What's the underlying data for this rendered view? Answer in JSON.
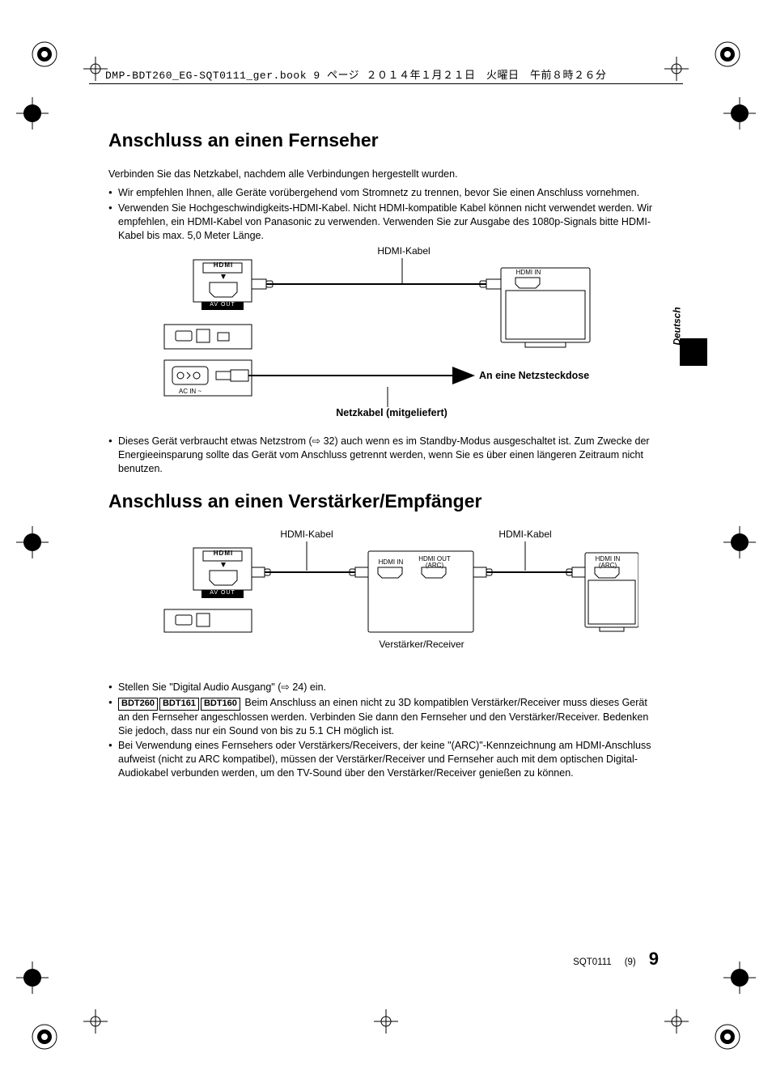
{
  "header": {
    "runner": "DMP-BDT260_EG-SQT0111_ger.book  9 ページ  ２０１４年１月２１日　火曜日　午前８時２６分"
  },
  "side_tab": {
    "language": "Deutsch"
  },
  "section1": {
    "title": "Anschluss an einen Fernseher",
    "intro": "Verbinden Sie das Netzkabel, nachdem alle Verbindungen hergestellt wurden.",
    "bullets": [
      "Wir empfehlen Ihnen, alle Geräte vorübergehend vom Stromnetz zu trennen, bevor Sie einen Anschluss vornehmen.",
      "Verwenden Sie Hochgeschwindigkeits-HDMI-Kabel. Nicht HDMI-kompatible Kabel können nicht verwendet werden. Wir empfehlen, ein HDMI-Kabel von Panasonic zu verwenden. Verwenden Sie zur Ausgabe des 1080p-Signals bitte HDMI-Kabel bis max. 5,0 Meter Länge."
    ],
    "diagram": {
      "hdmi_cable": "HDMI-Kabel",
      "hdmi_logo": "HDMI",
      "av_out": "AV OUT",
      "ac_in": "AC IN ~",
      "hdmi_in": "HDMI IN",
      "to_outlet": "An eine Netzsteckdose",
      "power_cable": "Netzkabel (mitgeliefert)"
    },
    "note_ref": "32",
    "note": "Dieses Gerät verbraucht etwas Netzstrom (⇨ 32) auch wenn es im Standby-Modus ausgeschaltet ist. Zum Zwecke der Energieeinsparung sollte das Gerät vom Anschluss getrennt werden, wenn Sie es über einen längeren Zeitraum nicht benutzen."
  },
  "section2": {
    "title": "Anschluss an einen Verstärker/Empfänger",
    "diagram": {
      "hdmi_cable_l": "HDMI-Kabel",
      "hdmi_cable_r": "HDMI-Kabel",
      "hdmi_logo": "HDMI",
      "av_out": "AV OUT",
      "hdmi_in": "HDMI IN",
      "hdmi_out_arc": "HDMI OUT\n(ARC)",
      "hdmi_in_arc": "HDMI IN\n(ARC)",
      "amp_label": "Verstärker/Receiver"
    },
    "bullet1_pre": "Stellen Sie \"Digital Audio Ausgang\" (⇨ ",
    "bullet1_ref": "24",
    "bullet1_post": ") ein.",
    "models": [
      "BDT260",
      "BDT161",
      "BDT160"
    ],
    "bullet2": " Beim Anschluss an einen nicht zu 3D kompatiblen Verstärker/Receiver muss dieses Gerät an den Fernseher angeschlossen werden. Verbinden Sie dann den Fernseher und den Verstärker/Receiver. Bedenken Sie jedoch, dass nur ein Sound von bis zu 5.1 CH möglich ist.",
    "bullet3": "Bei Verwendung eines Fernsehers oder Verstärkers/Receivers, der keine \"(ARC)\"-Kennzeichnung am HDMI-Anschluss aufweist (nicht zu ARC kompatibel), müssen der Verstärker/Receiver und Fernseher auch mit dem optischen Digital-Audiokabel verbunden werden, um den TV-Sound über den Verstärker/Receiver genießen zu können."
  },
  "footer": {
    "code": "SQT0111",
    "seq": "(9)",
    "page": "9"
  }
}
